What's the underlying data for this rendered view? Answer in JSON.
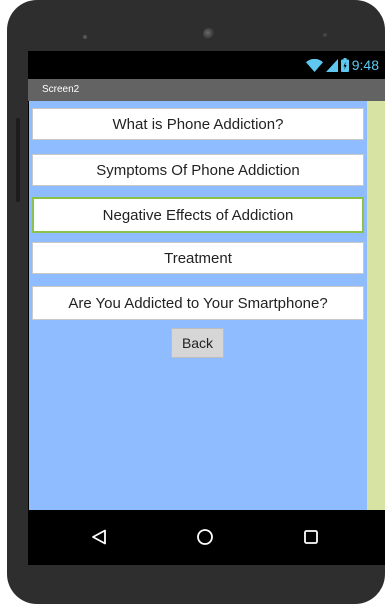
{
  "status_bar": {
    "time": "9:48",
    "wifi_icon": "wifi-icon",
    "signal_icon": "cell-signal-icon",
    "battery_icon": "battery-icon"
  },
  "title_bar": {
    "title": "Screen2"
  },
  "menu": {
    "buttons": [
      {
        "label": "What is Phone Addiction?"
      },
      {
        "label": "Symptoms Of Phone Addiction"
      },
      {
        "label": "Negative Effects of Addiction"
      },
      {
        "label": "Treatment"
      },
      {
        "label": "Are You Addicted to Your Smartphone?"
      }
    ],
    "back_label": "Back"
  },
  "nav_bar": {
    "back_icon": "triangle-back-icon",
    "home_icon": "circle-home-icon",
    "recents_icon": "square-recents-icon"
  },
  "colors": {
    "content_background": "#8fbcff",
    "side_strip": "#d7e3a3",
    "focus_border": "#8bc34a",
    "status_icon": "#5ec8f0",
    "title_bar": "#636363"
  }
}
